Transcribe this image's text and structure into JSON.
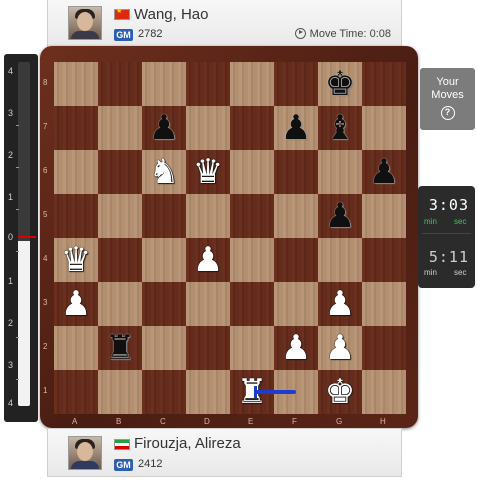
{
  "top_player": {
    "name": "Wang, Hao",
    "title": "GM",
    "rating": "2782",
    "flag": "china",
    "move_time_label": "Move Time: 0:08"
  },
  "bottom_player": {
    "name": "Firouzja, Alireza",
    "title": "GM",
    "rating": "2412",
    "flag": "iran"
  },
  "eval_bar": {
    "ticks_top": [
      "4",
      "3",
      "2",
      "1"
    ],
    "zero": "0",
    "ticks_bottom": [
      "1",
      "2",
      "3",
      "4"
    ],
    "white_fraction": 0.48
  },
  "side_panel": {
    "your_moves_line1": "Your",
    "your_moves_line2": "Moves",
    "help_icon": "?"
  },
  "clocks": {
    "top": {
      "time": "3:03",
      "min_label": "min",
      "sec_label": "sec",
      "state": "active"
    },
    "bottom": {
      "time": "5:11",
      "min_label": "min",
      "sec_label": "sec",
      "state": "idle"
    }
  },
  "board": {
    "files": [
      "A",
      "B",
      "C",
      "D",
      "E",
      "F",
      "G",
      "H"
    ],
    "ranks": [
      "8",
      "7",
      "6",
      "5",
      "4",
      "3",
      "2",
      "1"
    ],
    "pieces": [
      {
        "square": "g8",
        "color": "black",
        "type": "king"
      },
      {
        "square": "c7",
        "color": "black",
        "type": "pawn"
      },
      {
        "square": "f7",
        "color": "black",
        "type": "pawn"
      },
      {
        "square": "g7",
        "color": "black",
        "type": "bishop"
      },
      {
        "square": "c6",
        "color": "white",
        "type": "knight"
      },
      {
        "square": "d6",
        "color": "white",
        "type": "queen"
      },
      {
        "square": "h6",
        "color": "black",
        "type": "pawn"
      },
      {
        "square": "g5",
        "color": "black",
        "type": "pawn"
      },
      {
        "square": "a4",
        "color": "white",
        "type": "queen"
      },
      {
        "square": "d4",
        "color": "white",
        "type": "pawn"
      },
      {
        "square": "a3",
        "color": "white",
        "type": "pawn"
      },
      {
        "square": "g3",
        "color": "white",
        "type": "pawn"
      },
      {
        "square": "b2",
        "color": "black",
        "type": "rook"
      },
      {
        "square": "f2",
        "color": "white",
        "type": "pawn"
      },
      {
        "square": "g2",
        "color": "white",
        "type": "pawn"
      },
      {
        "square": "e1",
        "color": "white",
        "type": "rook"
      },
      {
        "square": "g1",
        "color": "white",
        "type": "king"
      }
    ],
    "last_move_arrow": {
      "from": "f1",
      "to": "e1",
      "color": "#1f3bd0"
    }
  }
}
